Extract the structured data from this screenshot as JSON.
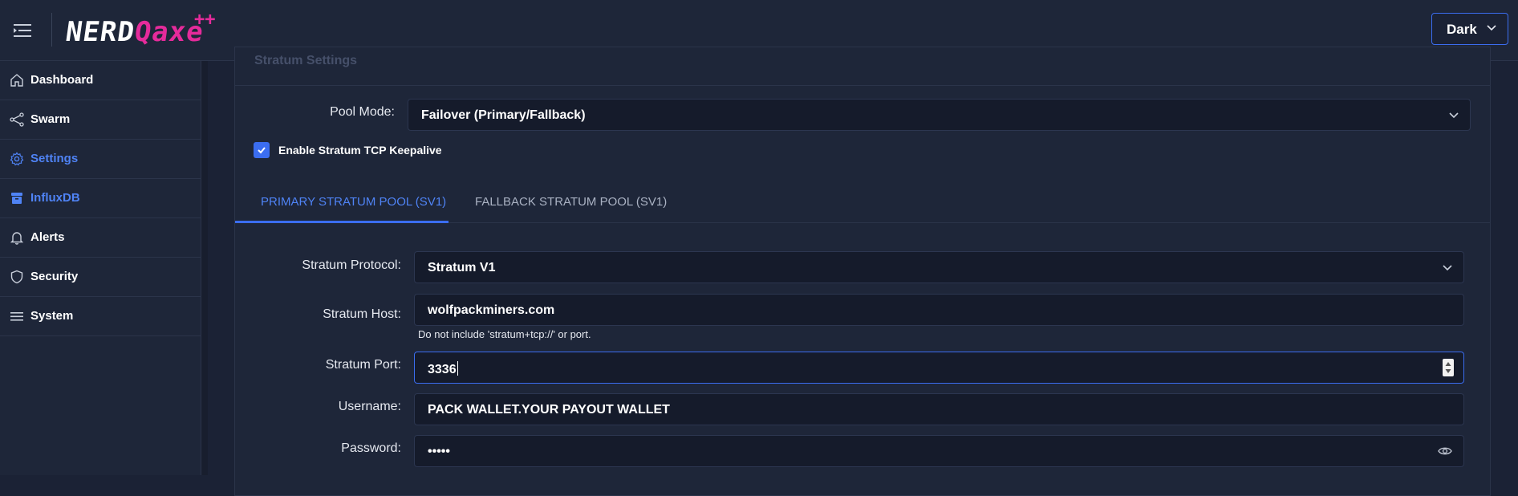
{
  "header": {
    "logo_main": "NERD",
    "logo_accent": "Qaxe",
    "logo_sup": "++",
    "theme": {
      "selected": "Dark"
    }
  },
  "sidebar": {
    "items": [
      {
        "label": "Dashboard",
        "icon": "home-icon",
        "active": false
      },
      {
        "label": "Swarm",
        "icon": "share-icon",
        "active": false
      },
      {
        "label": "Settings",
        "icon": "gear-icon",
        "active": true
      },
      {
        "label": "InfluxDB",
        "icon": "database-icon",
        "active": false
      },
      {
        "label": "Alerts",
        "icon": "bell-icon",
        "active": false
      },
      {
        "label": "Security",
        "icon": "shield-icon",
        "active": false
      },
      {
        "label": "System",
        "icon": "menu-icon",
        "active": false
      }
    ]
  },
  "panel": {
    "title": "Stratum Settings",
    "pool_mode": {
      "label": "Pool Mode:",
      "value": "Failover (Primary/Fallback)"
    },
    "keepalive": {
      "label": "Enable Stratum TCP Keepalive",
      "checked": true
    },
    "tabs": [
      {
        "label": "PRIMARY STRATUM POOL (SV1)",
        "active": true
      },
      {
        "label": "FALLBACK STRATUM POOL (SV1)",
        "active": false
      }
    ],
    "protocol": {
      "label": "Stratum Protocol:",
      "value": "Stratum V1"
    },
    "host": {
      "label": "Stratum Host:",
      "value": "wolfpackminers.com",
      "hint": "Do not include 'stratum+tcp://' or port."
    },
    "port": {
      "label": "Stratum Port:",
      "value": "3336"
    },
    "username": {
      "label": "Username:",
      "value": "PACK WALLET.YOUR PAYOUT WALLET"
    },
    "password": {
      "label": "Password:",
      "value": "•••••"
    }
  },
  "colors": {
    "accent": "#3b6df0",
    "brand": "#e52b9b",
    "bg": "#1b2235"
  }
}
